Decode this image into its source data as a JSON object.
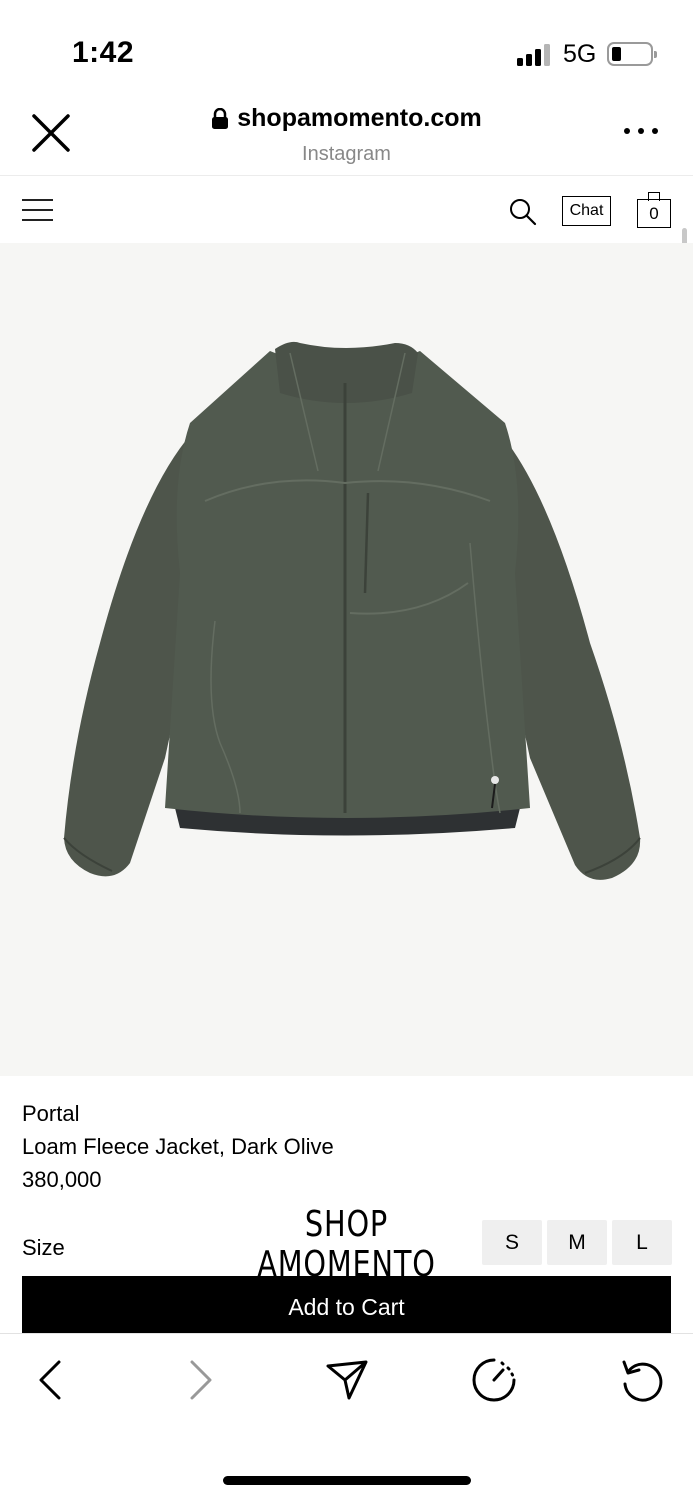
{
  "status_bar": {
    "time": "1:42",
    "network": "5G",
    "battery_level": 0.2
  },
  "browser": {
    "domain": "shopamomento.com",
    "source": "Instagram",
    "close_icon": "close-icon",
    "more_icon": "more-dots-icon",
    "secure_icon": "lock-icon"
  },
  "site_nav": {
    "menu_icon": "hamburger-icon",
    "search_icon": "search-icon",
    "chat_label": "Chat",
    "cart_count": "0"
  },
  "product": {
    "brand": "Portal",
    "name": "Loam Fleece Jacket, Dark Olive",
    "price": "380,000",
    "jacket_color": "#4e554b",
    "image_bg_color": "#f6f6f4"
  },
  "size_selector": {
    "label": "Size",
    "options": [
      "S",
      "M",
      "L"
    ]
  },
  "logo": {
    "line1": "SHOP",
    "line2": "AMOMENTO"
  },
  "add_to_cart_label": "Add to Cart",
  "toolbar": {
    "icons": [
      "back-icon",
      "forward-icon",
      "share-icon",
      "speed-icon",
      "reload-icon"
    ]
  }
}
